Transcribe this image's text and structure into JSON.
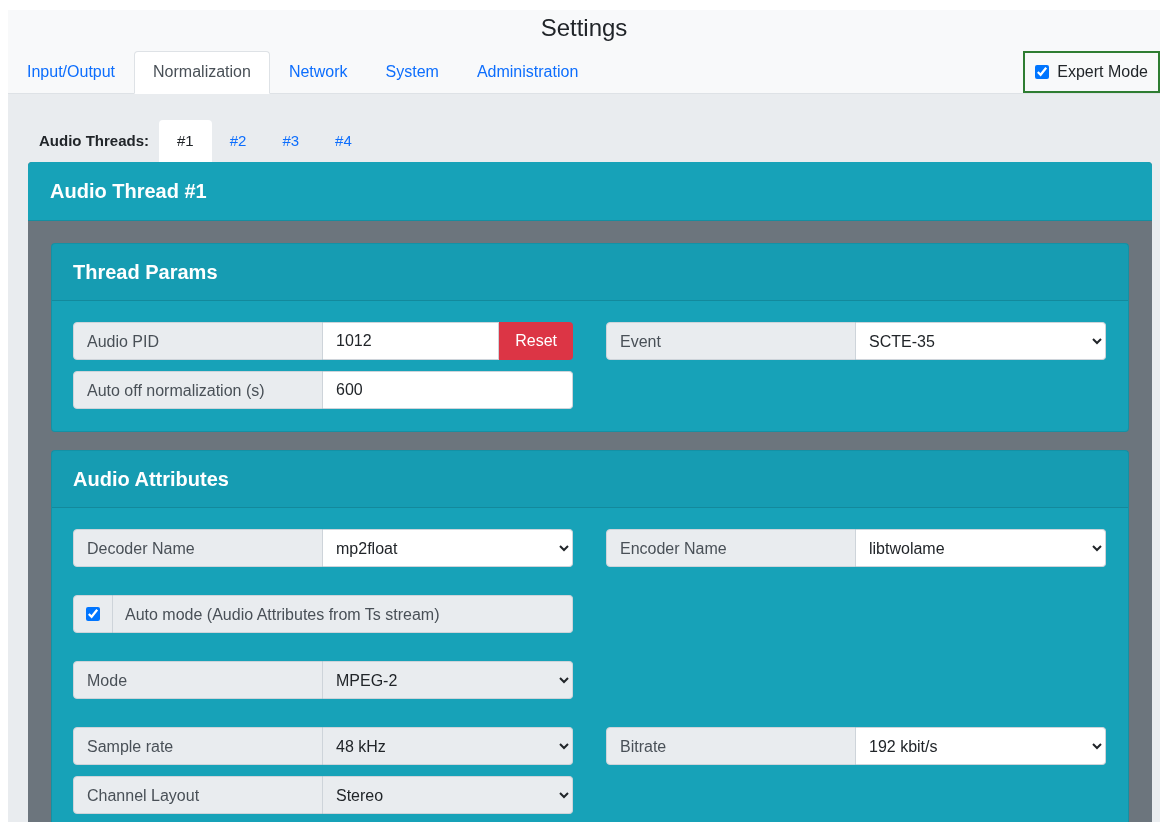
{
  "title": "Settings",
  "tabs": [
    {
      "label": "Input/Output",
      "selected": false
    },
    {
      "label": "Normalization",
      "selected": true
    },
    {
      "label": "Network",
      "selected": false
    },
    {
      "label": "System",
      "selected": false
    },
    {
      "label": "Administration",
      "selected": false
    }
  ],
  "expert_mode": {
    "label": "Expert Mode",
    "checked": true
  },
  "thread_tabs": {
    "label": "Audio Threads:",
    "items": [
      {
        "label": "#1",
        "selected": true
      },
      {
        "label": "#2",
        "selected": false
      },
      {
        "label": "#3",
        "selected": false
      },
      {
        "label": "#4",
        "selected": false
      }
    ]
  },
  "thread_card": {
    "title": "Audio Thread #1",
    "sections": [
      {
        "title": "Thread Params",
        "groups": [
          [
            [
              {
                "kind": "input",
                "label": "Audio PID",
                "value": "1012",
                "button": "Reset"
              },
              {
                "kind": "select",
                "label": "Event",
                "value": "SCTE-35",
                "disabled": false
              }
            ],
            [
              {
                "kind": "input",
                "label": "Auto off normalization (s)",
                "value": "600"
              }
            ]
          ]
        ]
      },
      {
        "title": "Audio Attributes",
        "groups": [
          [
            [
              {
                "kind": "select",
                "label": "Decoder Name",
                "value": "mp2float",
                "disabled": false
              },
              {
                "kind": "select",
                "label": "Encoder Name",
                "value": "libtwolame",
                "disabled": false
              }
            ]
          ],
          [
            [
              {
                "kind": "checkbox",
                "label": "Auto mode (Audio Attributes from Ts stream)",
                "checked": true
              }
            ]
          ],
          [
            [
              {
                "kind": "select",
                "label": "Mode",
                "value": "MPEG-2",
                "disabled": true
              }
            ]
          ],
          [
            [
              {
                "kind": "select",
                "label": "Sample rate",
                "value": "48 kHz",
                "disabled": true
              },
              {
                "kind": "select",
                "label": "Bitrate",
                "value": "192 kbit/s",
                "disabled": false
              }
            ],
            [
              {
                "kind": "select",
                "label": "Channel Layout",
                "value": "Stereo",
                "disabled": true
              }
            ]
          ]
        ]
      }
    ]
  }
}
